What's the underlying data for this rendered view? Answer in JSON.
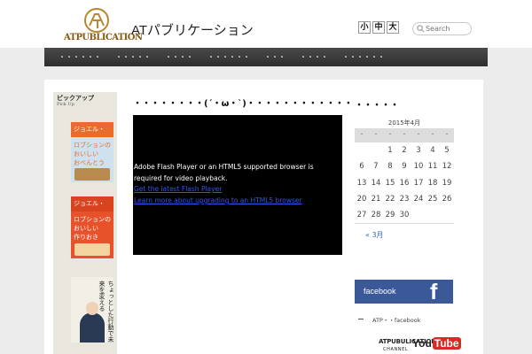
{
  "header": {
    "logo_text": "ATPUBLICATION",
    "site_title": "ATパブリケーション",
    "font_sizes": [
      "小",
      "中",
      "大"
    ],
    "search_placeholder": "Search"
  },
  "nav": {
    "items": [
      "・・・・・・",
      "・・・・・",
      "・・・・",
      "・・・・・・",
      "・・・",
      "・・・・",
      "・・・・・・"
    ]
  },
  "pickup": {
    "title": "ピックアップ",
    "subtitle": "Pick Up",
    "books": [
      {
        "band": "ジョエル・",
        "line1": "ロブションの",
        "line2": "おいしい",
        "line3": "おべんとう"
      },
      {
        "band": "ジョエル・",
        "line1": "ロブションの",
        "line2": "おいしい",
        "line3": "作りおき"
      },
      {
        "vertical": "ちょっとした行動で未来を変える"
      }
    ]
  },
  "article": {
    "title": "・・・・・・・・(´・ω・`)・・・・・・・・・・・・",
    "video_message": "Adobe Flash Player or an HTML5 supported browser is required for video playback.",
    "link_flash": "Get the latest Flash Player",
    "link_html5": "Learn more about upgrading to an HTML5 browser"
  },
  "sidebar": {
    "calendar_title": "・・・・・",
    "calendar": {
      "caption": "2015年4月",
      "weekdays": [
        "・",
        "・",
        "・",
        "・",
        "・",
        "・",
        "・"
      ],
      "days": [
        "",
        "",
        "1",
        "2",
        "3",
        "4",
        "5",
        "6",
        "7",
        "8",
        "9",
        "10",
        "11",
        "12",
        "13",
        "14",
        "15",
        "16",
        "17",
        "18",
        "19",
        "20",
        "21",
        "22",
        "23",
        "24",
        "25",
        "26",
        "27",
        "28",
        "29",
        "30"
      ],
      "prev_link": "« 3月"
    },
    "facebook_banner": "facebook",
    "facebook_f": "f",
    "facebook_link": "ATP・・facebook",
    "youtube_brand": "ATPUBULICATION",
    "youtube_channel": "CHANNEL",
    "youtube_you": "You",
    "youtube_tube": "Tube"
  },
  "colors": {
    "nav_background": "#3a3a3a",
    "facebook_blue": "#3b5998",
    "link_blue": "#3355ee",
    "youtube_red": "#d62b26"
  }
}
